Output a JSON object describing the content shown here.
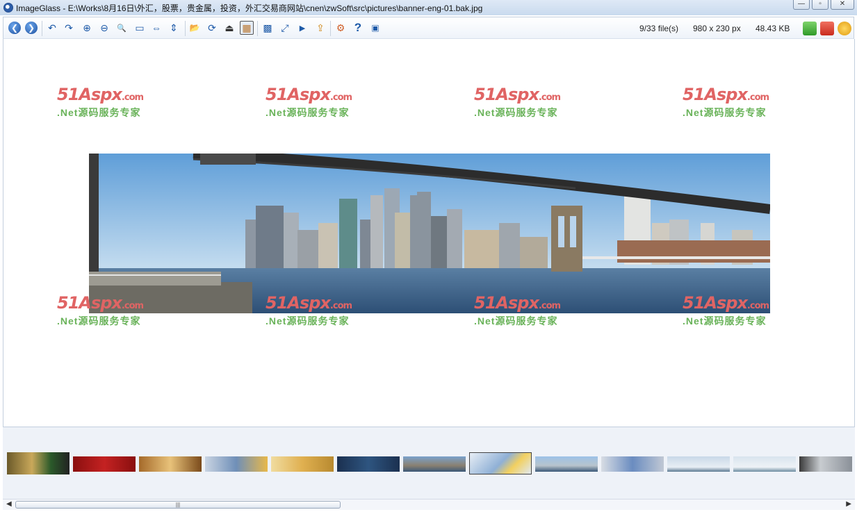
{
  "window": {
    "title": "ImageGlass - E:\\Works\\8月16日\\外汇，股票，贵金属，投资，外汇交易商网站\\cnen\\zwSoft\\src\\pictures\\banner-eng-01.bak.jpg",
    "controls": {
      "minimize": "—",
      "maximize": "▫",
      "close": "✕"
    }
  },
  "toolbar": {
    "buttons": [
      {
        "name": "back-icon",
        "glyph": "❮"
      },
      {
        "name": "forward-icon",
        "glyph": "❯"
      },
      {
        "name": "rotate-left-icon",
        "glyph": "↶"
      },
      {
        "name": "rotate-right-icon",
        "glyph": "↷"
      },
      {
        "name": "zoom-in-icon",
        "glyph": "⊕"
      },
      {
        "name": "zoom-out-icon",
        "glyph": "⊖"
      },
      {
        "name": "actual-size-icon",
        "glyph": "🔍"
      },
      {
        "name": "zoom-to-fit-icon",
        "glyph": "▭"
      },
      {
        "name": "fit-width-icon",
        "glyph": "⇔"
      },
      {
        "name": "fit-height-icon",
        "glyph": "⇕"
      },
      {
        "name": "open-file-icon",
        "glyph": "📂"
      },
      {
        "name": "refresh-icon",
        "glyph": "⟳"
      },
      {
        "name": "go-to-icon",
        "glyph": "⏏"
      },
      {
        "name": "thumbnail-toggle-icon",
        "glyph": "▦"
      },
      {
        "name": "checkerboard-icon",
        "glyph": "▩"
      },
      {
        "name": "fullscreen-icon",
        "glyph": "⤢"
      },
      {
        "name": "slideshow-icon",
        "glyph": "▶"
      },
      {
        "name": "convert-icon",
        "glyph": "⇪"
      },
      {
        "name": "settings-icon",
        "glyph": "⚙"
      },
      {
        "name": "help-icon",
        "glyph": "?"
      },
      {
        "name": "about-icon",
        "glyph": "▣"
      }
    ],
    "status": {
      "file_count": "9/33 file(s)",
      "dimensions": "980 x 230 px",
      "file_size": "48.43 KB"
    }
  },
  "watermark": {
    "logo": "51Aspx",
    "logo_suffix": ".com",
    "subtitle": ".Net源码服务专家"
  },
  "thumbnails": {
    "count": 13,
    "current_index": 7
  },
  "colors": {
    "watermark_red": "#e06464",
    "watermark_green": "#6ab35a",
    "accent_blue": "#1e5aa8"
  }
}
